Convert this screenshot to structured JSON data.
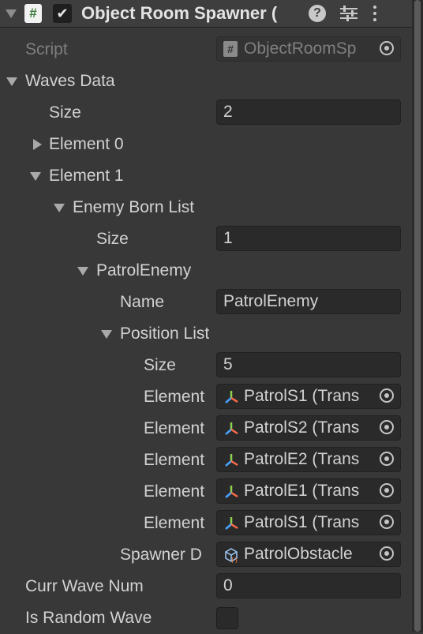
{
  "header": {
    "title": "Object Room Spawner (",
    "script_icon_glyph": "#",
    "enabled": true,
    "icons": [
      "foldout-arrow-icon",
      "script-icon",
      "checkbox-icon",
      "help-icon",
      "presets-icon",
      "more-menu-icon"
    ]
  },
  "script": {
    "label": "Script",
    "value": "ObjectRoomSp"
  },
  "waves_data": {
    "label": "Waves Data",
    "size_label": "Size",
    "size_value": "2",
    "element0_label": "Element 0",
    "element1_label": "Element 1",
    "enemy_born_list": {
      "label": "Enemy Born List",
      "size_label": "Size",
      "size_value": "1",
      "patrol_enemy": {
        "label": "PatrolEnemy",
        "name_label": "Name",
        "name_value": "PatrolEnemy",
        "position_list": {
          "label": "Position List",
          "size_label": "Size",
          "size_value": "5",
          "elements": [
            {
              "label": "Element",
              "value": "PatrolS1 (Trans"
            },
            {
              "label": "Element",
              "value": "PatrolS2 (Trans"
            },
            {
              "label": "Element",
              "value": "PatrolE2 (Trans"
            },
            {
              "label": "Element",
              "value": "PatrolE1 (Trans"
            },
            {
              "label": "Element",
              "value": "PatrolS1 (Trans"
            }
          ]
        },
        "spawner_label": "Spawner D",
        "spawner_value": "PatrolObstacle"
      }
    }
  },
  "curr_wave_num": {
    "label": "Curr Wave Num",
    "value": "0"
  },
  "is_random_wave": {
    "label": "Is Random Wave",
    "checked": false
  },
  "colors": {
    "background": "#383838",
    "field": "#2a2a2a",
    "text": "#d2d2d2",
    "dim_text": "#7f7f7f"
  }
}
